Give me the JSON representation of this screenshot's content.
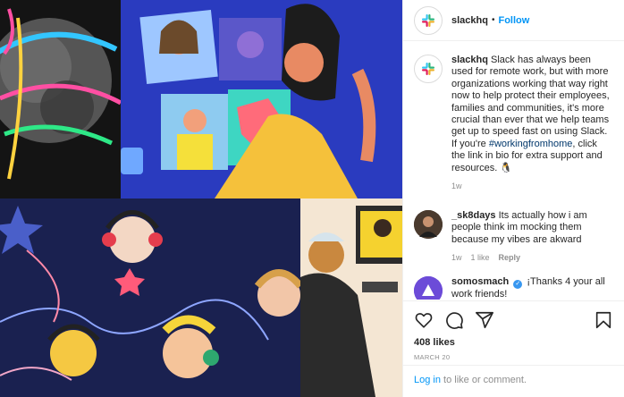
{
  "post": {
    "username": "slackhq",
    "separator": "•",
    "follow_label": "Follow"
  },
  "caption": {
    "username": "slackhq",
    "text_before": "Slack has always been used for remote work, but with more organizations working that way right now to help protect their employees, families and communities, it's more crucial than ever that we help teams get up to speed fast on using Slack. If you're ",
    "hashtag": "#workingfromhome",
    "text_after": ", click the link in bio for extra support and resources. 🐧",
    "time": "1w"
  },
  "comments": [
    {
      "username": "_sk8days",
      "text": "Its actually how i am people think im mocking them because my vibes are akward",
      "time": "1w",
      "likes": "1 like",
      "reply_label": "Reply"
    },
    {
      "username": "somosmach",
      "verified_mark": "✓",
      "text": "¡Thanks 4 your all work friends!"
    }
  ],
  "actions": {
    "likes": "408 likes",
    "date": "MARCH 20"
  },
  "login": {
    "link": "Log in",
    "text": " to like or comment."
  },
  "icons": {
    "like": "heart-icon",
    "comment": "comment-icon",
    "share": "share-icon",
    "save": "bookmark-icon"
  },
  "colors": {
    "follow": "#0095f6",
    "link": "#00376b",
    "muted": "#8e8e8e"
  }
}
